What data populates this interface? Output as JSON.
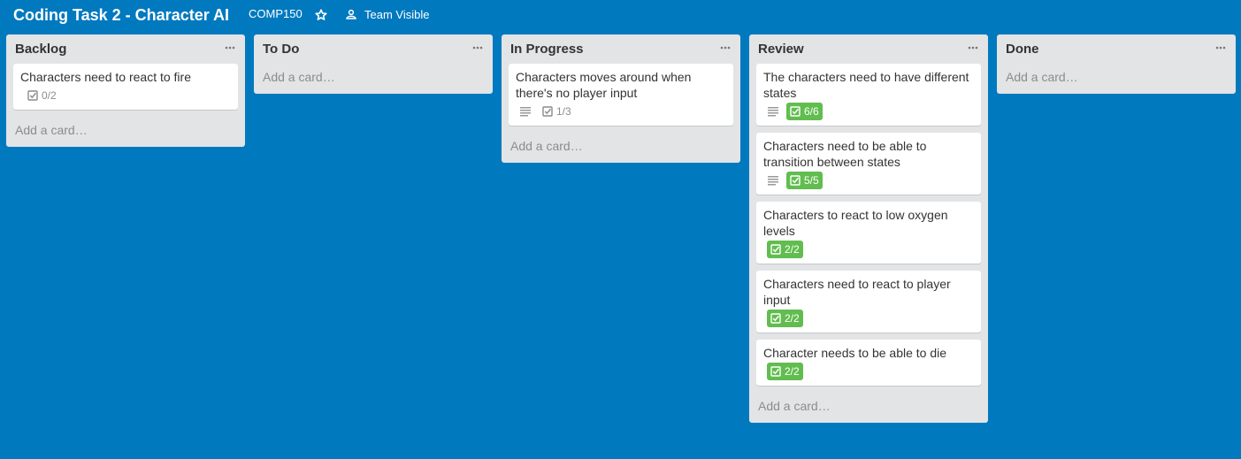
{
  "board": {
    "title": "Coding Task 2 - Character AI",
    "org": "COMP150",
    "visibility": "Team Visible",
    "star_icon": "star-icon",
    "visibility_icon": "team-icon"
  },
  "add_card_label": "Add a card…",
  "lists": [
    {
      "title": "Backlog",
      "cards": [
        {
          "title": "Characters need to react to fire",
          "checklist": "0/2",
          "complete": false,
          "description": false
        }
      ]
    },
    {
      "title": "To Do",
      "cards": []
    },
    {
      "title": "In Progress",
      "cards": [
        {
          "title": "Characters moves around when there's no player input",
          "checklist": "1/3",
          "complete": false,
          "description": true
        }
      ]
    },
    {
      "title": "Review",
      "cards": [
        {
          "title": "The characters need to have different states",
          "checklist": "6/6",
          "complete": true,
          "description": true
        },
        {
          "title": "Characters need to be able to transition between states",
          "checklist": "5/5",
          "complete": true,
          "description": true
        },
        {
          "title": "Characters to react to low oxygen levels",
          "checklist": "2/2",
          "complete": true,
          "description": false
        },
        {
          "title": "Characters need to react to player input",
          "checklist": "2/2",
          "complete": true,
          "description": false
        },
        {
          "title": "Character needs to be able to die",
          "checklist": "2/2",
          "complete": true,
          "description": false
        }
      ]
    },
    {
      "title": "Done",
      "cards": []
    }
  ],
  "colors": {
    "board_background": "#0079bf",
    "list_background": "#e2e4e6",
    "checklist_complete": "#61bd4f"
  }
}
